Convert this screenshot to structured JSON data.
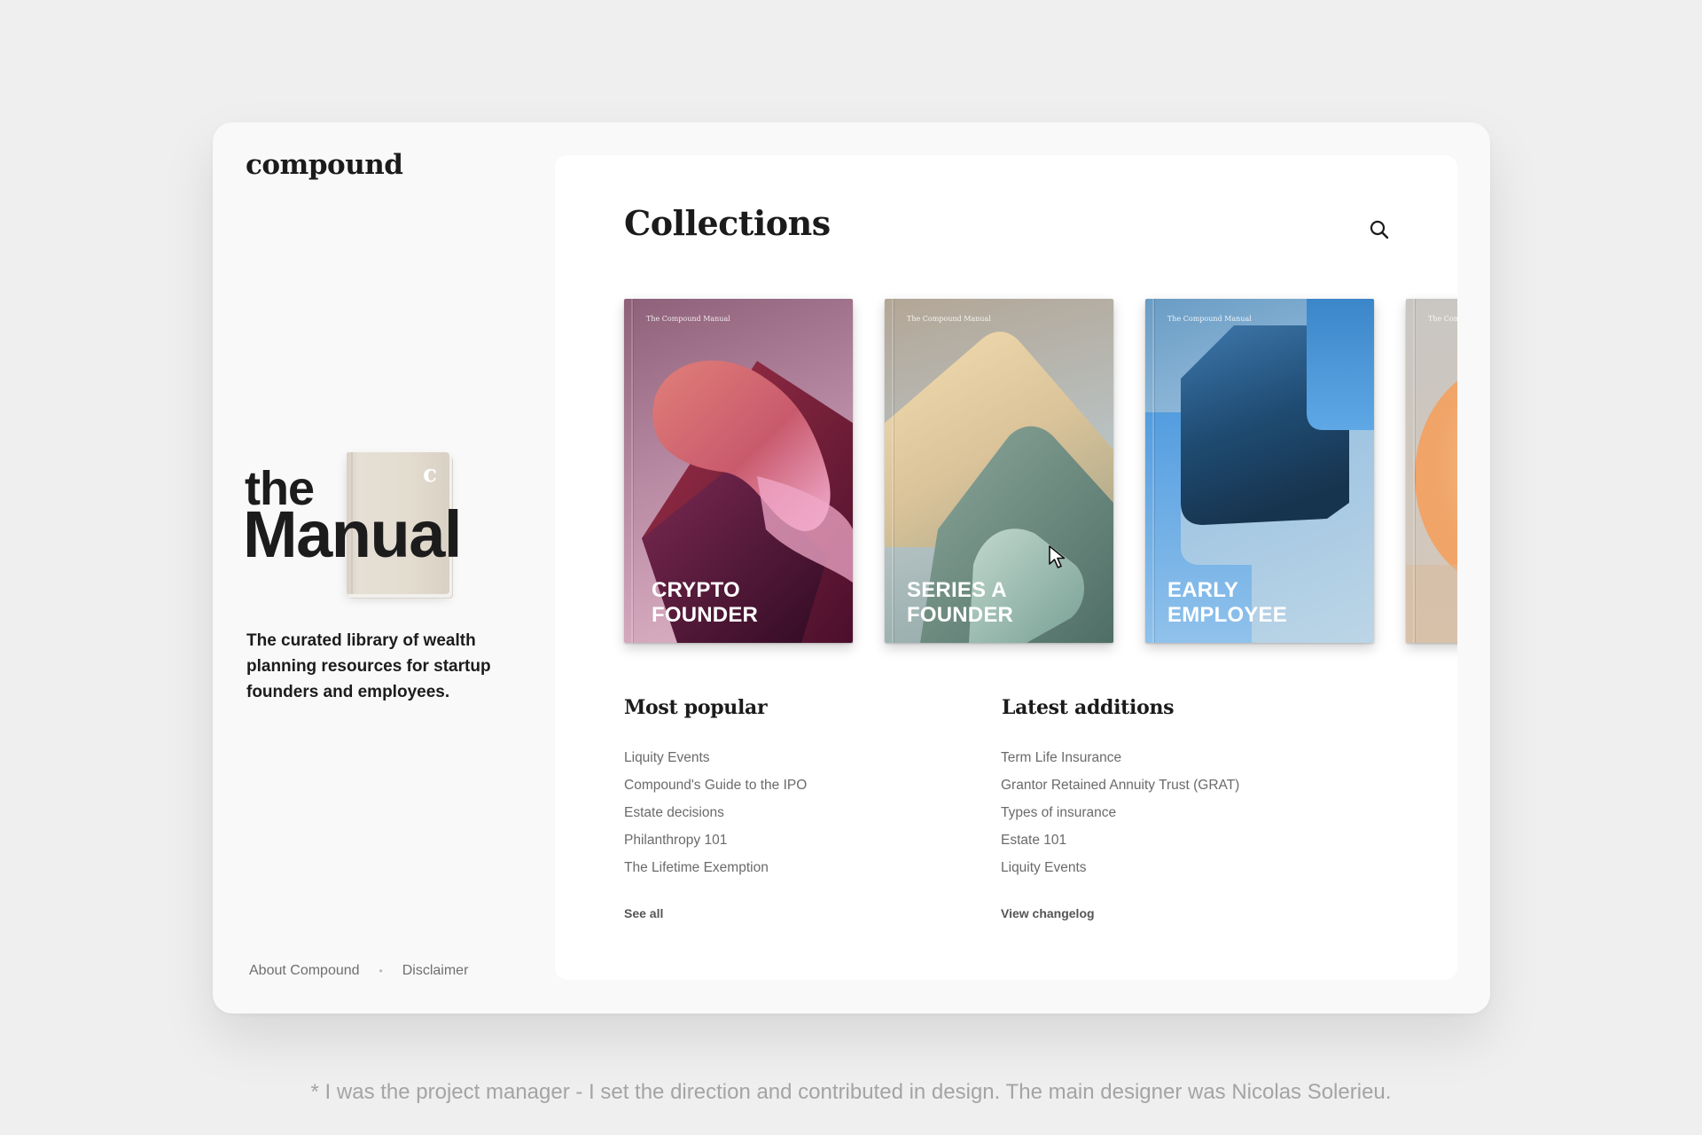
{
  "brand": {
    "name": "compound"
  },
  "hero": {
    "the_word": "the",
    "manual_word": "Manual",
    "book_mark": "c",
    "tagline": "The curated library of wealth planning resources for startup founders and employees."
  },
  "footer": {
    "about": "About Compound",
    "separator": "•",
    "disclaimer": "Disclaimer"
  },
  "collections": {
    "title": "Collections",
    "series_label": "The Compound Manual",
    "books": [
      {
        "title_line1": "Crypto",
        "title_line2": "Founder"
      },
      {
        "title_line1": "Series A",
        "title_line2": "Founder"
      },
      {
        "title_line1": "Early",
        "title_line2": "Employee"
      },
      {
        "title_line1": "",
        "title_line2": ""
      }
    ]
  },
  "most_popular": {
    "title": "Most popular",
    "items": [
      "Liquity Events",
      "Compound's Guide to the IPO",
      "Estate decisions",
      "Philanthropy 101",
      "The Lifetime Exemption"
    ],
    "link": "See all"
  },
  "latest_additions": {
    "title": "Latest additions",
    "items": [
      "Term Life Insurance",
      "Grantor Retained Annuity Trust (GRAT)",
      "Types of insurance",
      "Estate 101",
      "Liquity Events"
    ],
    "link": "View changelog"
  },
  "caption": "* I was the project manager - I set the direction and contributed in design. The main designer was Nicolas Solerieu.",
  "icons": {
    "search": "search-icon",
    "cursor": "cursor-arrow-icon"
  },
  "colors": {
    "background": "#efefef",
    "text_dark": "#1b1b1b",
    "text_muted": "#6a6a6a"
  }
}
